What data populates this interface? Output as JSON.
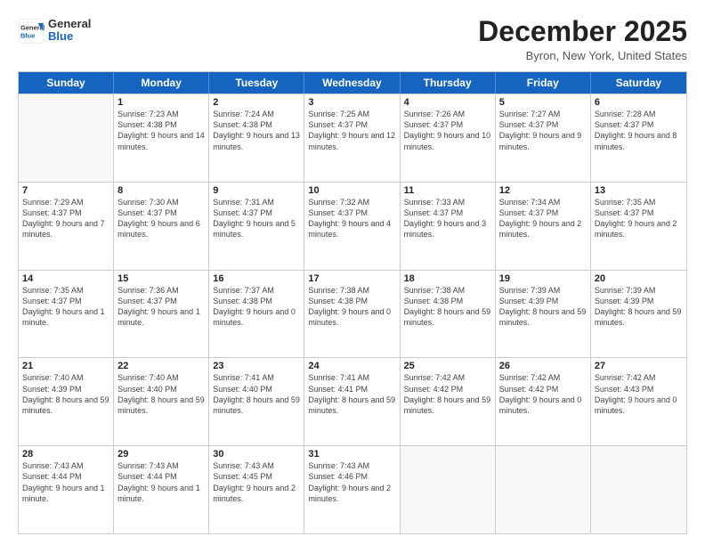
{
  "header": {
    "logo_general": "General",
    "logo_blue": "Blue",
    "month_title": "December 2025",
    "location": "Byron, New York, United States"
  },
  "calendar": {
    "days_of_week": [
      "Sunday",
      "Monday",
      "Tuesday",
      "Wednesday",
      "Thursday",
      "Friday",
      "Saturday"
    ],
    "rows": [
      [
        {
          "day": "",
          "empty": true
        },
        {
          "day": "1",
          "sunrise": "7:23 AM",
          "sunset": "4:38 PM",
          "daylight": "9 hours and 14 minutes."
        },
        {
          "day": "2",
          "sunrise": "7:24 AM",
          "sunset": "4:38 PM",
          "daylight": "9 hours and 13 minutes."
        },
        {
          "day": "3",
          "sunrise": "7:25 AM",
          "sunset": "4:37 PM",
          "daylight": "9 hours and 12 minutes."
        },
        {
          "day": "4",
          "sunrise": "7:26 AM",
          "sunset": "4:37 PM",
          "daylight": "9 hours and 10 minutes."
        },
        {
          "day": "5",
          "sunrise": "7:27 AM",
          "sunset": "4:37 PM",
          "daylight": "9 hours and 9 minutes."
        },
        {
          "day": "6",
          "sunrise": "7:28 AM",
          "sunset": "4:37 PM",
          "daylight": "9 hours and 8 minutes."
        }
      ],
      [
        {
          "day": "7",
          "sunrise": "7:29 AM",
          "sunset": "4:37 PM",
          "daylight": "9 hours and 7 minutes."
        },
        {
          "day": "8",
          "sunrise": "7:30 AM",
          "sunset": "4:37 PM",
          "daylight": "9 hours and 6 minutes."
        },
        {
          "day": "9",
          "sunrise": "7:31 AM",
          "sunset": "4:37 PM",
          "daylight": "9 hours and 5 minutes."
        },
        {
          "day": "10",
          "sunrise": "7:32 AM",
          "sunset": "4:37 PM",
          "daylight": "9 hours and 4 minutes."
        },
        {
          "day": "11",
          "sunrise": "7:33 AM",
          "sunset": "4:37 PM",
          "daylight": "9 hours and 3 minutes."
        },
        {
          "day": "12",
          "sunrise": "7:34 AM",
          "sunset": "4:37 PM",
          "daylight": "9 hours and 2 minutes."
        },
        {
          "day": "13",
          "sunrise": "7:35 AM",
          "sunset": "4:37 PM",
          "daylight": "9 hours and 2 minutes."
        }
      ],
      [
        {
          "day": "14",
          "sunrise": "7:35 AM",
          "sunset": "4:37 PM",
          "daylight": "9 hours and 1 minute."
        },
        {
          "day": "15",
          "sunrise": "7:36 AM",
          "sunset": "4:37 PM",
          "daylight": "9 hours and 1 minute."
        },
        {
          "day": "16",
          "sunrise": "7:37 AM",
          "sunset": "4:38 PM",
          "daylight": "9 hours and 0 minutes."
        },
        {
          "day": "17",
          "sunrise": "7:38 AM",
          "sunset": "4:38 PM",
          "daylight": "9 hours and 0 minutes."
        },
        {
          "day": "18",
          "sunrise": "7:38 AM",
          "sunset": "4:38 PM",
          "daylight": "8 hours and 59 minutes."
        },
        {
          "day": "19",
          "sunrise": "7:39 AM",
          "sunset": "4:39 PM",
          "daylight": "8 hours and 59 minutes."
        },
        {
          "day": "20",
          "sunrise": "7:39 AM",
          "sunset": "4:39 PM",
          "daylight": "8 hours and 59 minutes."
        }
      ],
      [
        {
          "day": "21",
          "sunrise": "7:40 AM",
          "sunset": "4:39 PM",
          "daylight": "8 hours and 59 minutes."
        },
        {
          "day": "22",
          "sunrise": "7:40 AM",
          "sunset": "4:40 PM",
          "daylight": "8 hours and 59 minutes."
        },
        {
          "day": "23",
          "sunrise": "7:41 AM",
          "sunset": "4:40 PM",
          "daylight": "8 hours and 59 minutes."
        },
        {
          "day": "24",
          "sunrise": "7:41 AM",
          "sunset": "4:41 PM",
          "daylight": "8 hours and 59 minutes."
        },
        {
          "day": "25",
          "sunrise": "7:42 AM",
          "sunset": "4:42 PM",
          "daylight": "8 hours and 59 minutes."
        },
        {
          "day": "26",
          "sunrise": "7:42 AM",
          "sunset": "4:42 PM",
          "daylight": "9 hours and 0 minutes."
        },
        {
          "day": "27",
          "sunrise": "7:42 AM",
          "sunset": "4:43 PM",
          "daylight": "9 hours and 0 minutes."
        }
      ],
      [
        {
          "day": "28",
          "sunrise": "7:43 AM",
          "sunset": "4:44 PM",
          "daylight": "9 hours and 1 minute."
        },
        {
          "day": "29",
          "sunrise": "7:43 AM",
          "sunset": "4:44 PM",
          "daylight": "9 hours and 1 minute."
        },
        {
          "day": "30",
          "sunrise": "7:43 AM",
          "sunset": "4:45 PM",
          "daylight": "9 hours and 2 minutes."
        },
        {
          "day": "31",
          "sunrise": "7:43 AM",
          "sunset": "4:46 PM",
          "daylight": "9 hours and 2 minutes."
        },
        {
          "day": "",
          "empty": true
        },
        {
          "day": "",
          "empty": true
        },
        {
          "day": "",
          "empty": true
        }
      ]
    ]
  }
}
